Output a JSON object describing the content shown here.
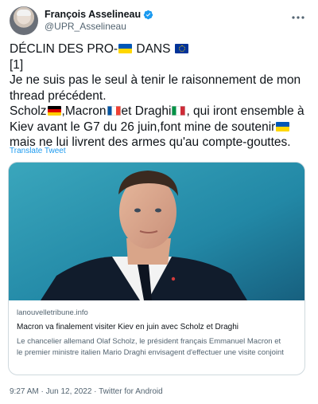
{
  "author": {
    "display_name": "François Asselineau",
    "handle": "@UPR_Asselineau",
    "verified": true,
    "avatar_icon": "profile-photo"
  },
  "more_icon": "more-options-icon",
  "tweet": {
    "lines": [
      "DÉCLIN DES PRO-",
      " DANS ",
      "[1]",
      "Je ne suis pas le seul à tenir le raisonnement de mon",
      "thread précédent.",
      "Scholz",
      ",Macron",
      "et Draghi",
      ", qui iront ensemble à",
      "Kiev avant le G7 du 26 juin,font mine de soutenir",
      "mais ne lui livrent des armes qu'au compte-gouttes."
    ],
    "flags": [
      "ukraine-flag-icon",
      "eu-flag-icon",
      "germany-flag-icon",
      "france-flag-icon",
      "italy-flag-icon",
      "ukraine-flag-icon"
    ]
  },
  "translate_label": "Translate Tweet",
  "card": {
    "domain": "lanouvelletribune.info",
    "title": "Macron va finalement visiter Kiev en juin avec Scholz et Draghi",
    "description_line1": "Le chancelier allemand Olaf Scholz, le président français Emmanuel Macron et",
    "description_line2": "le premier ministre italien Mario Draghi envisagent d'effectuer une visite conjoint"
  },
  "meta": {
    "text": "9:27 AM · Jun 12, 2022 · Twitter for Android"
  },
  "colors": {
    "link": "#1d9bf0",
    "secondary_text": "#536471",
    "verified": "#1d9bf0"
  }
}
